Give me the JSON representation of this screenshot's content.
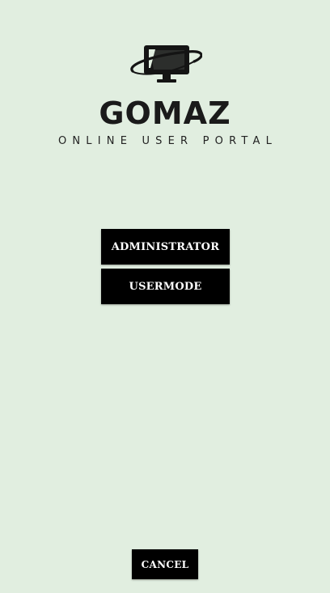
{
  "brand": {
    "logo_icon": "computer-monitor-orbit-icon",
    "title": "GOMAZ",
    "subtitle": "ONLINE USER PORTAL"
  },
  "mode_buttons": {
    "administrator_label": "ADMINISTRATOR",
    "usermode_label": "USERMODE"
  },
  "footer": {
    "cancel_label": "CANCEL"
  },
  "colors": {
    "background": "#e1eee0",
    "button_bg": "#000000",
    "button_text": "#ffffff",
    "brand_text": "#1a1a1a"
  }
}
